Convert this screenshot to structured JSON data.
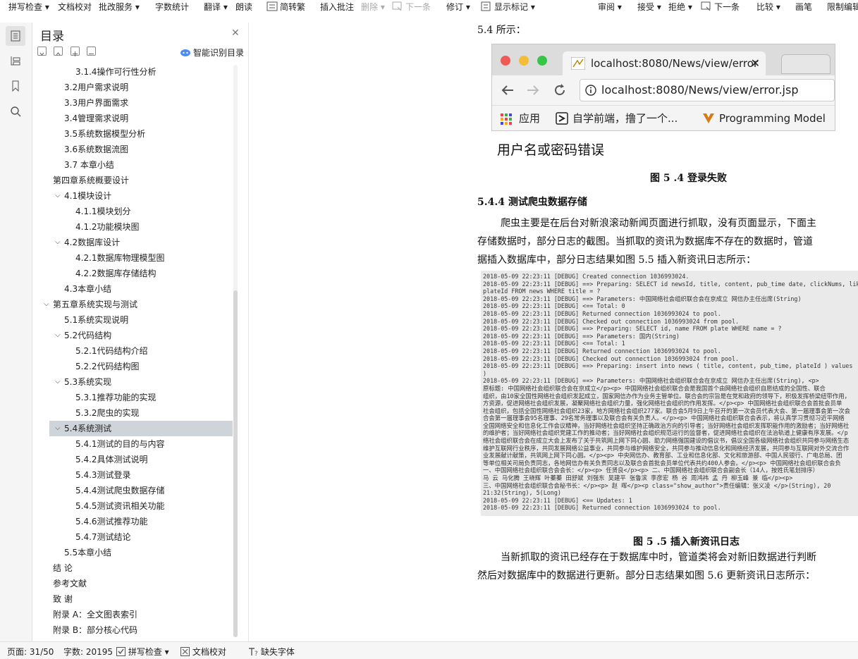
{
  "toolbar": {
    "spell_check": "拼写检查",
    "doc_proof": "文档校对",
    "batch_service": "批改服务",
    "word_count": "字数统计",
    "translate": "翻译",
    "read_aloud": "朗读",
    "simp_trad": "简转繁",
    "insert_comment": "插入批注",
    "delete": "删除",
    "next": "下一条",
    "revise": "修订",
    "show_marks": "显示标记",
    "review": "审阅",
    "accept": "接受",
    "reject": "拒绝",
    "next2": "下一条",
    "compare": "比较",
    "pen": "画笔",
    "restrict_edit": "限制编辑"
  },
  "toc": {
    "title": "目录",
    "smart_label": "智能识别目录",
    "items": [
      "3.1.4操作可行性分析",
      "3.2用户需求说明",
      "3.3用户界面需求",
      "3.4管理需求说明",
      "3.5系统数据模型分析",
      "3.6系统数据流图",
      "3.7  本章小结",
      "第四章系统概要设计",
      "4.1模块设计",
      "4.1.1模块划分",
      "4.1.2功能模块图",
      "4.2数据库设计",
      "4.2.1数据库物理模型图",
      "4.2.2数据库存储结构",
      "4.3本章小结",
      "第五章系统实现与测试",
      "5.1系统实现说明",
      "5.2代码结构",
      "5.2.1代码结构介绍",
      "5.2.2代码结构图",
      "5.3系统实现",
      "5.3.1推荐功能的实现",
      "5.3.2爬虫的实现",
      "5.4系统测试",
      "5.4.1测试的目的与内容",
      "5.4.2具体测试说明",
      "5.4.3测试登录",
      "5.4.4测试爬虫数据存储",
      "5.4.5测试资讯相关功能",
      "5.4.6测试推荐功能",
      "5.4.7测试结论",
      "5.5本章小结",
      "结    论",
      "参考文献",
      "致    谢",
      "附录 A：全文图表索引",
      "附录 B：部分核心代码"
    ]
  },
  "doc": {
    "top_text": "5.4 所示：",
    "browser": {
      "tab": "localhost:8080/News/view/error",
      "url": "localhost:8080/News/view/error.jsp",
      "bm_apps": "应用",
      "bm_1": "自学前端，撸了一个...",
      "bm_2": "Programming Model",
      "error_text": "用户名或密码错误"
    },
    "fig54": "图  5 .4 登录失败",
    "section": "5.4.4  测试爬虫数据存储",
    "para1_l1": "爬虫主要是在后台对新浪滚动新闻页面进行抓取，没有页面显示，下面主",
    "para1_l2": "存储数据时，部分日志的截图。当抓取的资讯为数据库不存在的数据时，管道",
    "para1_l3": "据插入数据库中，部分日志结果如图 5.5 插入新资讯日志所示：",
    "log": [
      "2018-05-09 22:23:11 [DEBUG] Created connection 1036993024.",
      "2018-05-09 22:23:11 [DEBUG] ==>  Preparing: SELECT id newsId, title, content, pub_time date, clickNums, lik",
      "  plateId FROM news WHERE title = ?",
      "2018-05-09 22:23:11 [DEBUG] ==> Parameters: 中国网络社会组织联合会在京成立 网信办主任出席(String)",
      "2018-05-09 22:23:11 [DEBUG] <==      Total: 0",
      "2018-05-09 22:23:11 [DEBUG] Returned connection 1036993024 to pool.",
      "2018-05-09 22:23:11 [DEBUG] Checked out connection 1036993024 from pool.",
      "2018-05-09 22:23:11 [DEBUG] ==>  Preparing: SELECT id, name FROM plate WHERE name = ?",
      "2018-05-09 22:23:11 [DEBUG] ==> Parameters: 国内(String)",
      "2018-05-09 22:23:11 [DEBUG] <==      Total: 1",
      "2018-05-09 22:23:11 [DEBUG] Returned connection 1036993024 to pool.",
      "2018-05-09 22:23:11 [DEBUG] Checked out connection 1036993024 from pool.",
      "2018-05-09 22:23:11 [DEBUG] ==>  Preparing: insert into news ( title, content, pub_time, plateId ) values",
      "  )",
      "2018-05-09 22:23:11 [DEBUG] ==> Parameters: 中国网络社会组织联合会在京成立 网信办主任出席(String), <p>",
      "      原标题: 中国网络社会组织联合会在京成立</p><p>     中国网络社会组织联合会是我国首个由网络社会组织自愿结成的全国性、联合",
      "组织，由10家全国性网络社会组织发起成立，国家网信办作为业务主管单位。联合会的宗旨是在党和政府的领导下，积极发挥桥梁纽带作用，",
      "方资源，促进网络社会组织发展，凝聚网络社会组织力量，强化网络社会组织的作用发挥。</p><p>    中国网络社会组织联合会首批会员单",
      "社会组织，包括全国性网络社会组织23家，地方网络社会组织277家。联合会5月9日上午召开的第一次会员代表大会、第一届理事会第一次会",
      "合会第一届理事会95名理事、29名常务理事以及联合会有关负责人。</p><p>    中国网络社会组织联合会表示，将认真学习贯彻习近平网络",
      "全国网络安全和信息化工作会议精神，当好网络社会组织坚持正确政治方向的引导者；当好网络社会组织发挥职能作用的激励者；当好网络社",
      "的维护者；当好网络社会组织党建工作的推动者；当好网络社会组织规范运行的监督者，促进网络社会组织在法治轨道上健康有序发展。</p",
      "络社会组织联合会在成立大会上发布了关于共筑网上网下同心圆、助力网络强国建设的倡议书，倡议全国各级网络社会组织共同参与网络生态",
      "维护互联网行业秩序，共同发展网络公益事业，共同参与维护网络安全，共同参与推动信息化和网络经济发展，共同参与互联网对外交流合作",
      "业发展献计献策，共筑网上网下同心圆。</p><p>    中央网信办、教育部、工业和信息化部、文化和旅游部、中国人民银行、广电总局、团",
      "等单位相关司局负责同志，各地网信办有关负责同志以及联合会首批会员单位代表共约400人参会。</p><p>    中国网络社会组织联合会负",
      "      一、中国网络社会组织联合会会长：</p><p>    任贤良</p><p>    二、中国网络社会组织联合会副会长（14人，按姓氏笔划排序）",
      "      马 云 马化腾 王晓辉 叶蓁蓁 田舒斌 刘强东 吴建平 张鲁滨 李彦宏 杨 谷 周鸿祎 孟 丹 柳玉峰 景 临</p><p>",
      "      三、中国网络社会组织联合会秘书长：</p><p>    赵 晖</p><p class=\"show_author\">责任编辑：张义凌 </p>(String), 20",
      "  21:32(String), 5(Long)",
      "2018-05-09 22:23:11 [DEBUG] <==    Updates: 1",
      "2018-05-09 22:23:11 [DEBUG] Returned connection 1036993024 to pool."
    ],
    "fig55": "图  5 .5 插入新资讯日志",
    "para2_l1": "当新抓取的资讯已经存在于数据库中时，管道类将会对新旧数据进行判断",
    "para2_l2": "然后对数据库中的数据进行更新。部分日志结果如图 5.6 更新资讯日志所示："
  },
  "status": {
    "page": "页面: 31/50",
    "words": "字数: 20195",
    "spell": "拼写检查",
    "proof": "文档校对",
    "missing_font": "缺失字体"
  }
}
